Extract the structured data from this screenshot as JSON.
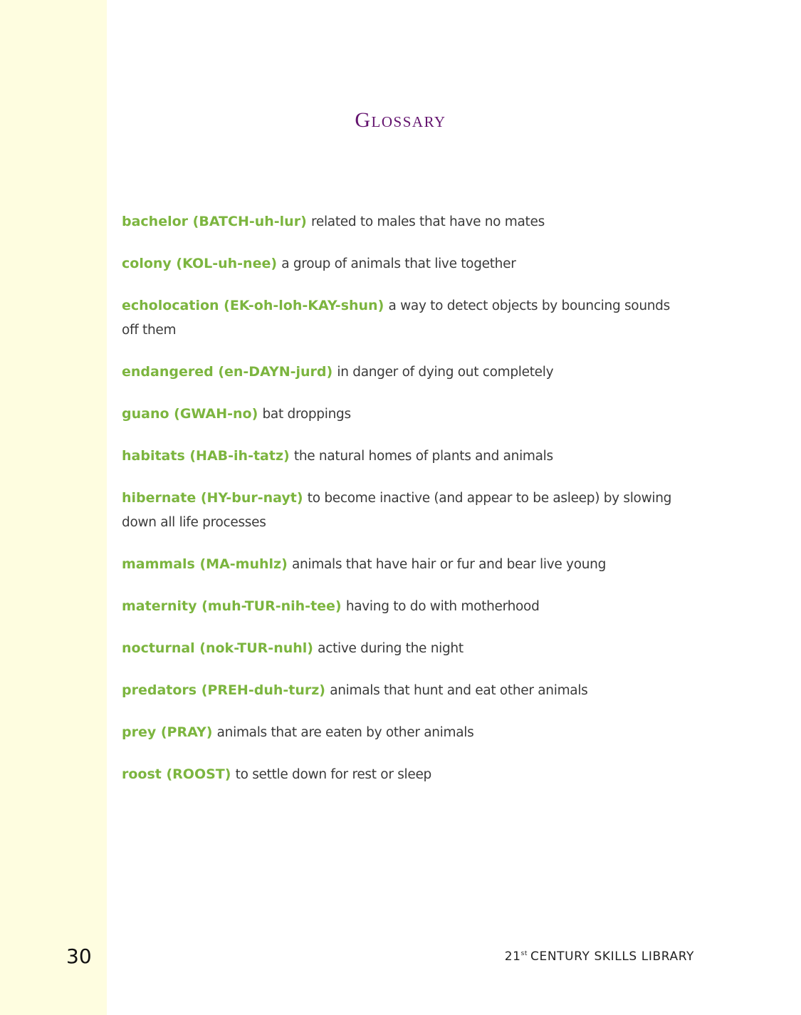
{
  "title": "Glossary",
  "entries": [
    {
      "term": "bachelor (BATCH-uh-lur)",
      "definition": "related to males that have no mates"
    },
    {
      "term": "colony (KOL-uh-nee)",
      "definition": "a group of animals that live together"
    },
    {
      "term": "echolocation (EK-oh-loh-KAY-shun)",
      "definition": "a way to detect objects by bouncing sounds off them"
    },
    {
      "term": "endangered (en-DAYN-jurd)",
      "definition": "in danger of dying out completely"
    },
    {
      "term": "guano (GWAH-no)",
      "definition": "bat droppings"
    },
    {
      "term": "habitats (HAB-ih-tatz)",
      "definition": "the natural homes of plants and animals"
    },
    {
      "term": "hibernate (HY-bur-nayt)",
      "definition": "to become inactive (and appear to be asleep) by slowing down all life processes"
    },
    {
      "term": "mammals (MA-muhlz)",
      "definition": "animals that have hair or fur and bear live young"
    },
    {
      "term": "maternity (muh-TUR-nih-tee)",
      "definition": "having to do with motherhood"
    },
    {
      "term": "nocturnal (nok-TUR-nuhl)",
      "definition": "active during the night"
    },
    {
      "term": "predators (PREH-duh-turz)",
      "definition": "animals that hunt and eat other animals"
    },
    {
      "term": "prey (PRAY)",
      "definition": "animals that are eaten by other animals"
    },
    {
      "term": "roost (ROOST)",
      "definition": "to settle down for rest or sleep"
    }
  ],
  "footer": {
    "page_number": "30",
    "series_prefix": "21",
    "series_superscript": "st",
    "series_suffix": "CENTURY SKILLS LIBRARY"
  },
  "colors": {
    "title": "#63136e",
    "term": "#7cb53f",
    "margin_band": "#fefde0"
  }
}
